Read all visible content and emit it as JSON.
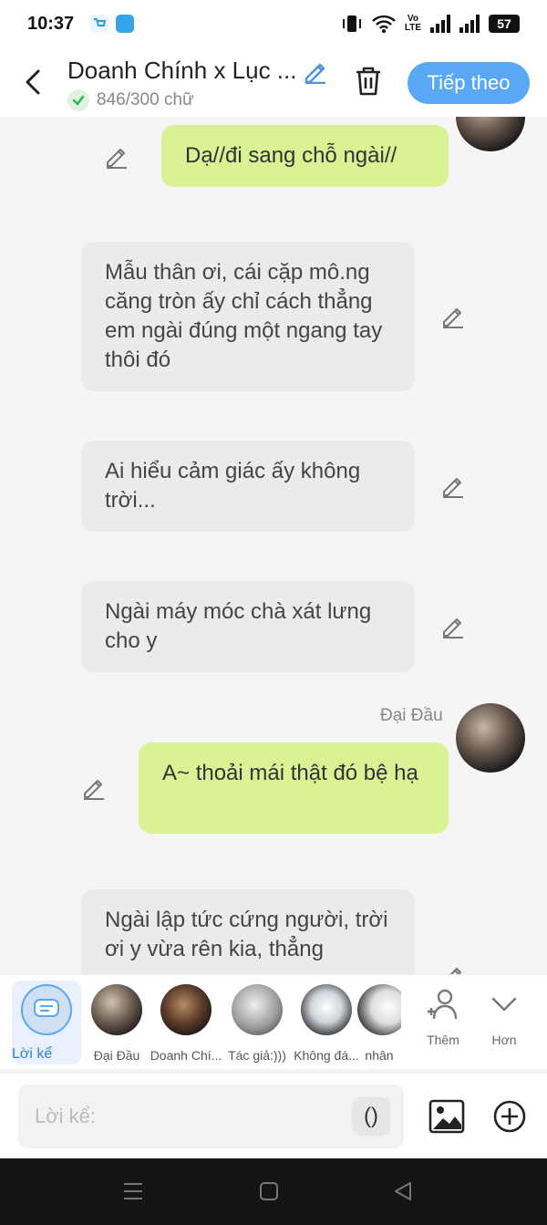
{
  "status_bar": {
    "time": "10:37",
    "network_label_top": "Vo",
    "network_label_bottom": "LTE",
    "battery": "57"
  },
  "header": {
    "title": "Doanh Chính x Lục ...",
    "char_count": "846/300 chữ",
    "next_label": "Tiếp theo"
  },
  "messages": [
    {
      "side": "right",
      "text": "Dạ//đi sang chỗ ngài//"
    },
    {
      "side": "left",
      "text": "Mẫu thân ơi, cái cặp mô.ng căng tròn ấy chỉ cách thẳng em ngài đúng một ngang tay thôi đó"
    },
    {
      "side": "left",
      "text": "Ai hiểu cảm giác ấy không trời..."
    },
    {
      "side": "left",
      "text": "Ngài máy móc chà xát lưng cho y"
    },
    {
      "side": "right",
      "speaker": "Đại Đầu",
      "text": "A~ thoải mái thật đó bệ hạ"
    },
    {
      "side": "left",
      "text": "Ngài lập tức cứng người, trời ơi y vừa rên kia, thẳng"
    }
  ],
  "characters": [
    {
      "name": "Lời kể",
      "selected": true
    },
    {
      "name": "Đại Đầu"
    },
    {
      "name": "Doanh Chí..."
    },
    {
      "name": "Tác giả:)))"
    },
    {
      "name": "Không đá..."
    },
    {
      "name": "nhân"
    }
  ],
  "actions": {
    "add_label": "Thêm",
    "more_label": "Hơn"
  },
  "input": {
    "placeholder": "Lời kể:",
    "paren_label": "()"
  },
  "colors": {
    "accent": "#59a8f5",
    "user_bubble": "#d9f294",
    "other_bubble": "#ebebeb"
  }
}
